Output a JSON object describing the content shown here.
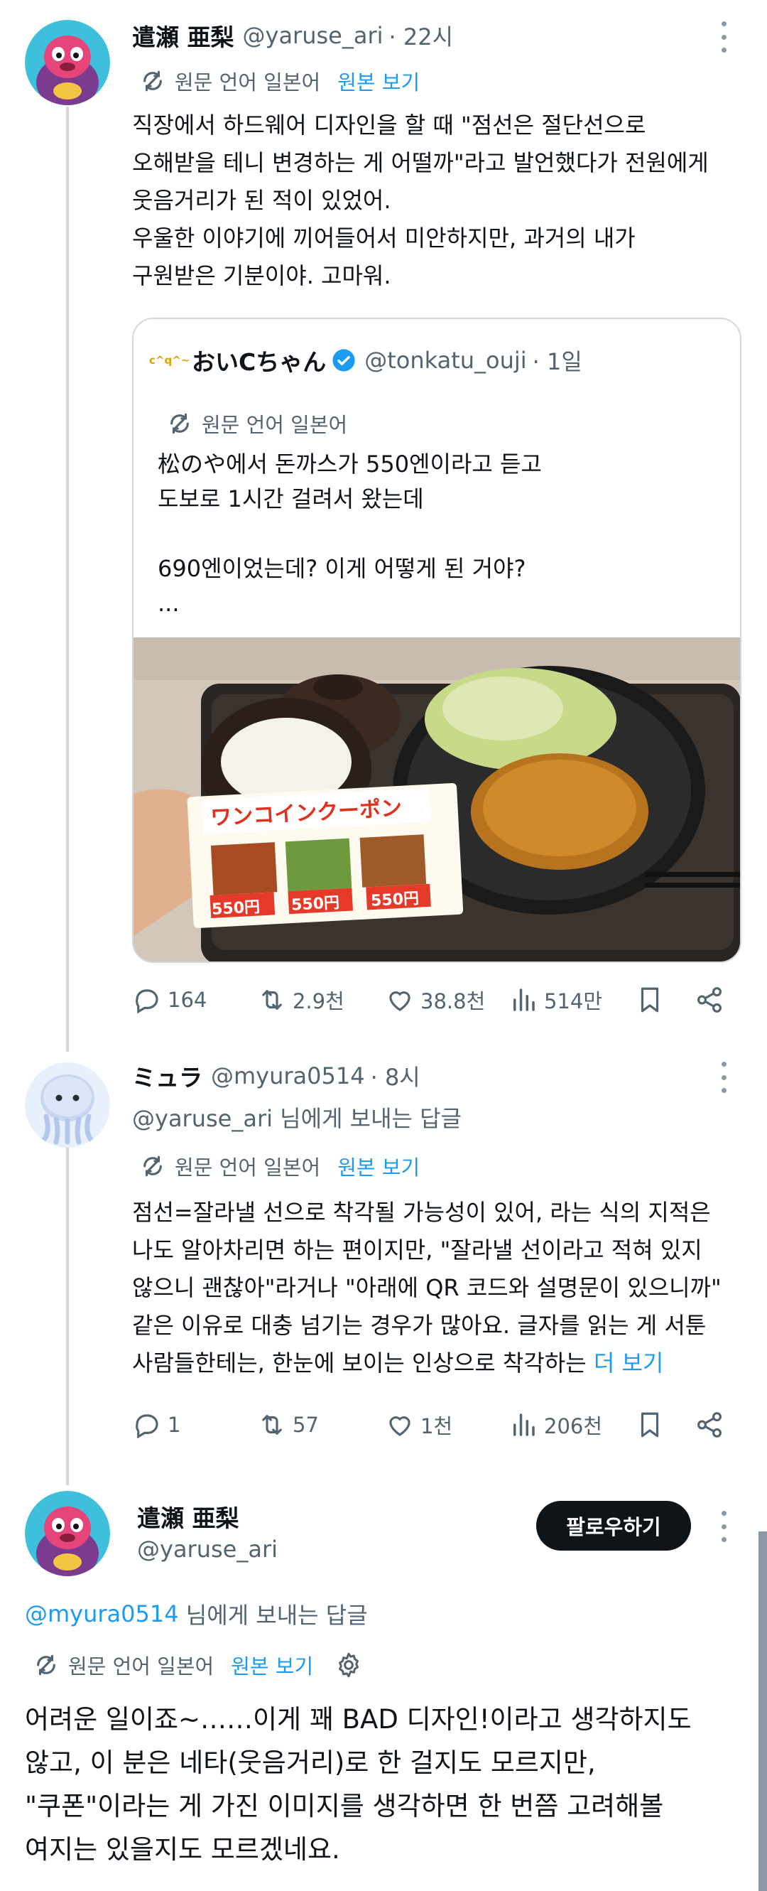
{
  "tweet1": {
    "name": "遣瀬 亜梨",
    "handle": "@yaruse_ari",
    "time": "· 22시",
    "translate": {
      "label": "원문 언어 일본어",
      "show_original": "원본 보기"
    },
    "body": "직장에서 하드웨어 디자인을 할 때 \"점선은 절단선으로\n오해받을 테니 변경하는 게 어떨까\"라고 발언했다가 전원에게\n웃음거리가 된 적이 있었어.\n우울한 이야기에 끼어들어서 미안하지만, 과거의 내가\n구원받은 기분이야. 고마워.",
    "quote": {
      "avatar_text": "c^q^~",
      "name": "おいCちゃん",
      "handle": "@tonkatu_ouji",
      "time": "· 1일",
      "translate_label": "원문 언어 일본어",
      "body": "松のや에서 돈까스가 550엔이라고 듣고\n도보로 1시간 걸려서 왔는데\n\n690엔이었는데? 이게 어떻게 된 거야?\n...",
      "coupon_title": "ワンコインクーポン",
      "coupon_prices": [
        "550円",
        "550円",
        "550円"
      ]
    },
    "actions": {
      "replies": "164",
      "retweets": "2.9천",
      "likes": "38.8천",
      "views": "514만"
    }
  },
  "tweet2": {
    "name": "ミュラ",
    "handle": "@myura0514",
    "time": "· 8시",
    "reply_to": "@yaruse_ari 님에게 보내는 답글",
    "translate": {
      "label": "원문 언어 일본어",
      "show_original": "원본 보기"
    },
    "body": "점선=잘라낼 선으로 착각될 가능성이 있어, 라는 식의 지적은\n나도 알아차리면 하는 편이지만, \"잘라낼 선이라고 적혀 있지\n않으니 괜찮아\"라거나 \"아래에 QR 코드와 설명문이 있으니까\"\n같은 이유로 대충 넘기는 경우가 많아요. 글자를 읽는 게 서툰\n사람들한테는, 한눈에 보이는 인상으로 착각하는 ",
    "more": "더 보기",
    "actions": {
      "replies": "1",
      "retweets": "57",
      "likes": "1천",
      "views": "206천"
    }
  },
  "tweet3": {
    "name": "遣瀬 亜梨",
    "handle": "@yaruse_ari",
    "follow_label": "팔로우하기",
    "reply_to_handle": "@myura0514",
    "reply_to_suffix": " 님에게 보내는 답글",
    "translate": {
      "label": "원문 언어 일본어",
      "show_original": "원본 보기"
    },
    "body": "어려운 일이죠~……이게 꽤 BAD 디자인!이라고 생각하지도\n않고, 이 분은 네타(웃음거리)로 한 걸지도 모르지만,\n\"쿠폰\"이라는 게 가진 이미지를 생각하면 한 번쯤 고려해볼\n여지는 있을지도 모르겠네요."
  },
  "colors": {
    "link": "#1d9bf0",
    "text": "#0f1419",
    "secondary": "#536471",
    "verified": "#1d9bf0"
  },
  "icons": [
    "translate-icon",
    "more-dots-icon",
    "reply-icon",
    "retweet-icon",
    "like-icon",
    "views-icon",
    "bookmark-icon",
    "share-icon",
    "settings-gear-icon",
    "verified-badge-icon"
  ]
}
